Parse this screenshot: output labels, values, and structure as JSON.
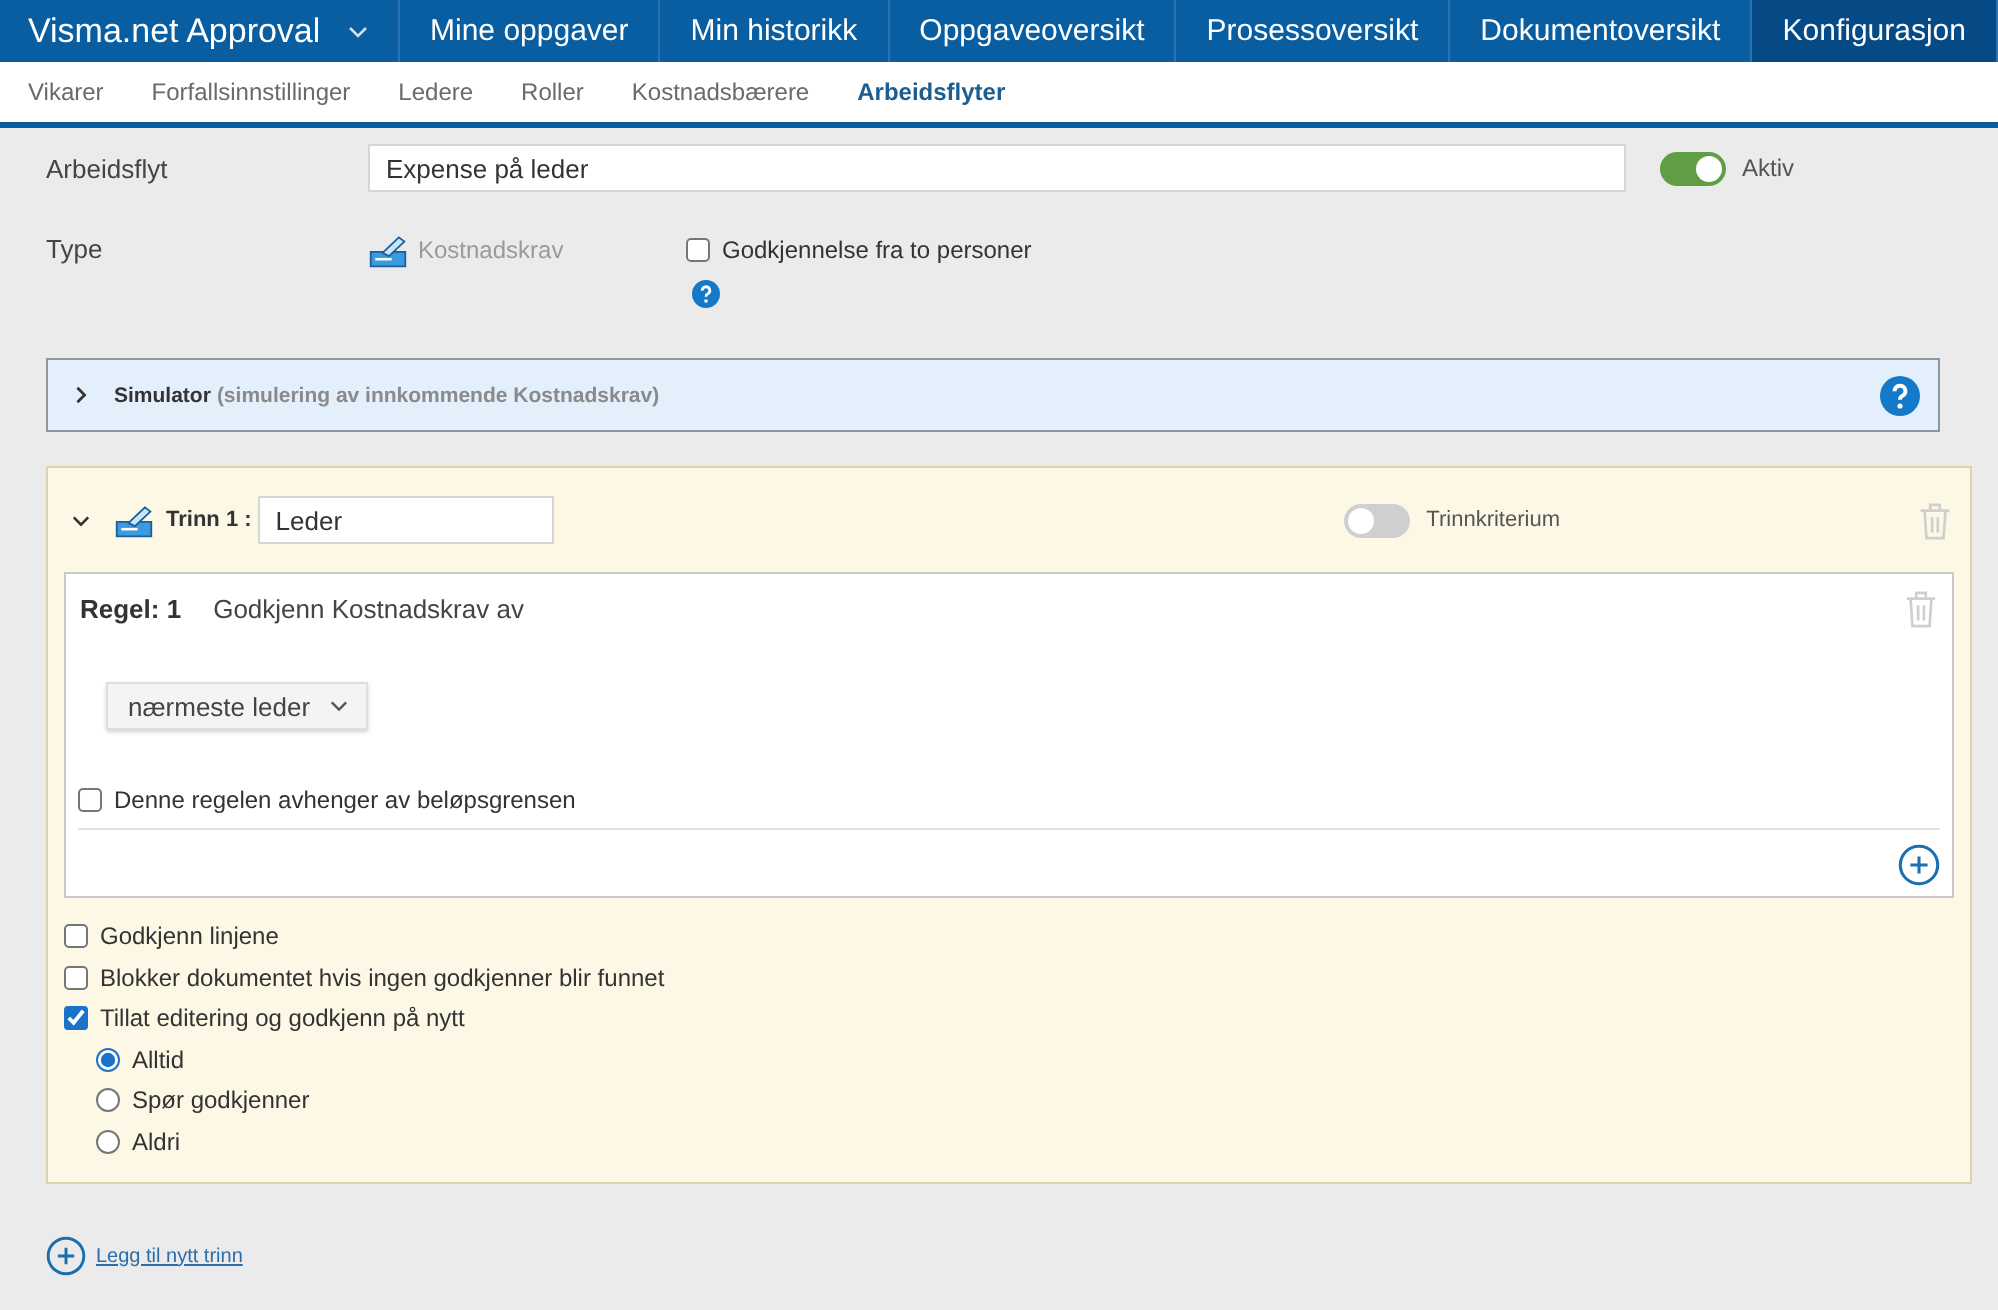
{
  "top_nav": {
    "app_title": "Visma.net Approval",
    "tabs": [
      {
        "label": "Mine oppgaver",
        "selected": false
      },
      {
        "label": "Min historikk",
        "selected": false
      },
      {
        "label": "Oppgaveoversikt",
        "selected": false
      },
      {
        "label": "Prosessoversikt",
        "selected": false
      },
      {
        "label": "Dokumentoversikt",
        "selected": false
      },
      {
        "label": "Konfigurasjon",
        "selected": true
      }
    ]
  },
  "sub_nav": {
    "tabs": [
      {
        "label": "Vikarer",
        "selected": false
      },
      {
        "label": "Forfallsinnstillinger",
        "selected": false
      },
      {
        "label": "Ledere",
        "selected": false
      },
      {
        "label": "Roller",
        "selected": false
      },
      {
        "label": "Kostnadsbærere",
        "selected": false
      },
      {
        "label": "Arbeidsflyter",
        "selected": true
      }
    ]
  },
  "workflow": {
    "name_label": "Arbeidsflyt",
    "name_value": "Expense på leder",
    "active": {
      "label": "Aktiv",
      "on": true
    },
    "type_label": "Type",
    "type_value": "Kostnadskrav",
    "two_person_approval": {
      "label": "Godkjennelse fra to personer",
      "checked": false
    }
  },
  "simulator": {
    "title": "Simulator",
    "subtitle": "(simulering av innkommende Kostnadskrav)",
    "expanded": false
  },
  "steps": [
    {
      "label": "Trinn 1 :",
      "name_value": "Leder",
      "expanded": true,
      "criterion": {
        "label": "Trinnkriterium",
        "on": false
      },
      "rules": [
        {
          "label": "Regel: 1",
          "description": "Godkjenn Kostnadskrav av",
          "approver": "nærmeste leder",
          "amount_limit": {
            "label": "Denne regelen avhenger av beløpsgrensen",
            "checked": false
          }
        }
      ],
      "options": [
        {
          "label": "Godkjenn linjene",
          "checked": false
        },
        {
          "label": "Blokker dokumentet hvis ingen godkjenner blir funnet",
          "checked": false
        },
        {
          "label": "Tillat editering og godkjenn på nytt",
          "checked": true,
          "choices": [
            {
              "label": "Alltid",
              "selected": true
            },
            {
              "label": "Spør godkjenner",
              "selected": false
            },
            {
              "label": "Aldri",
              "selected": false
            }
          ]
        }
      ]
    }
  ],
  "add_step_link": "Legg til nytt trinn"
}
